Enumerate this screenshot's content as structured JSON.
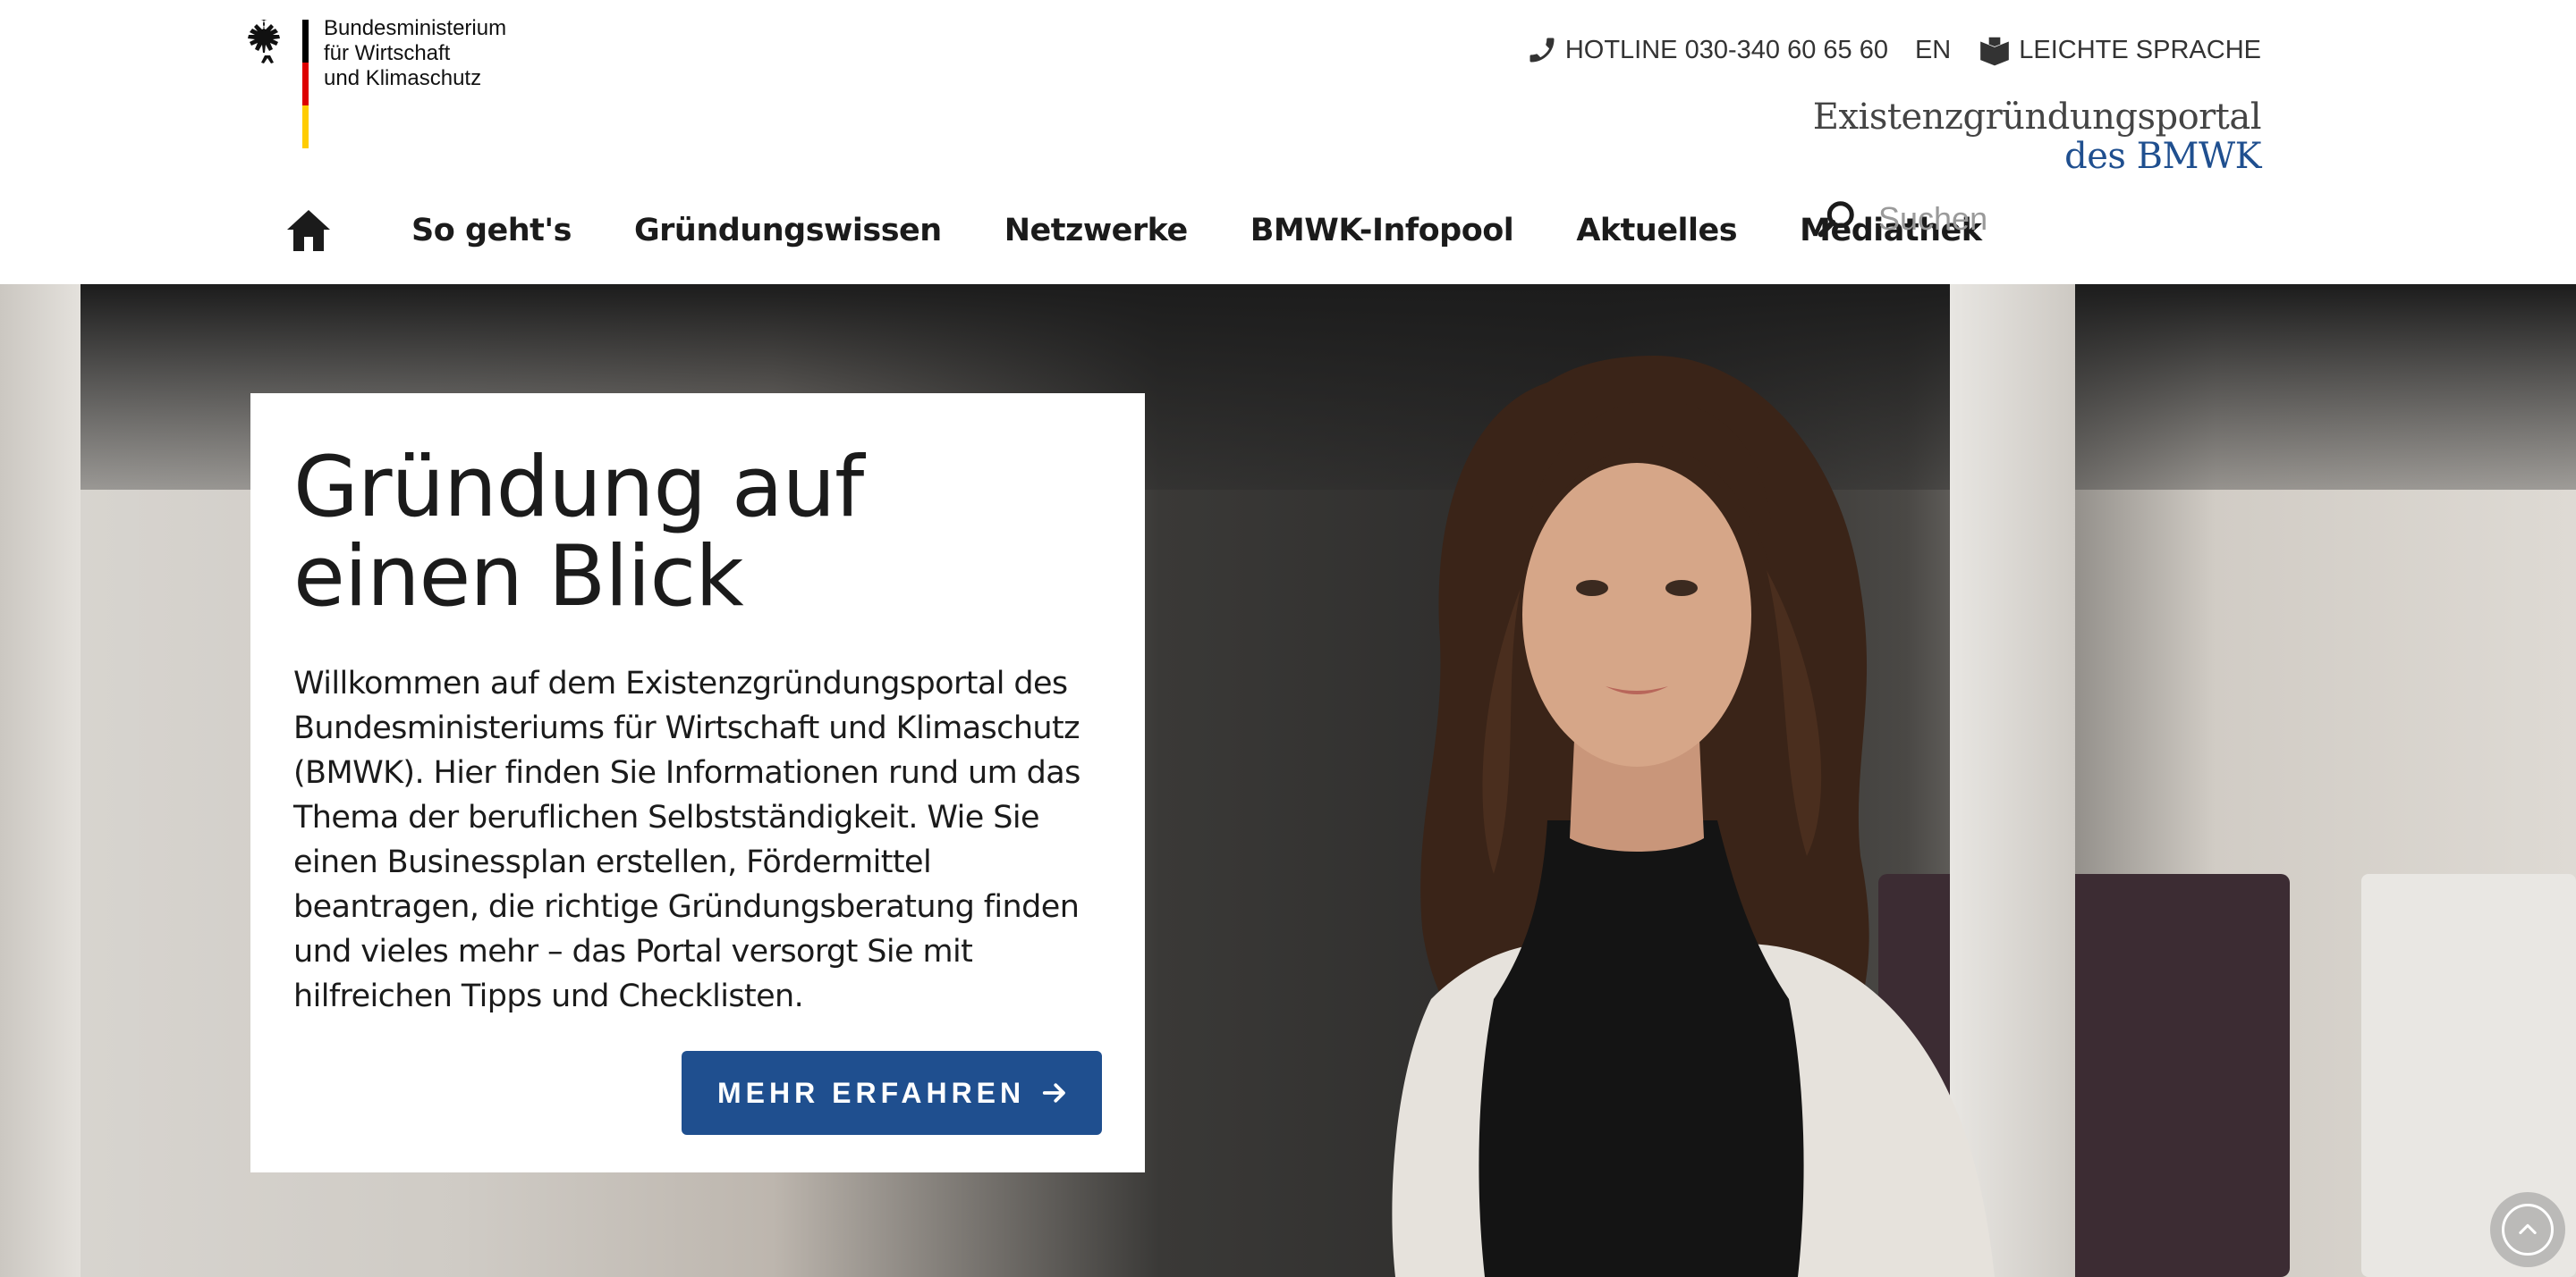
{
  "header": {
    "ministry_lines": [
      "Bundesministerium",
      "für Wirtschaft",
      "und Klimaschutz"
    ],
    "hotline": "HOTLINE 030-340 60 65 60",
    "lang": "EN",
    "easy_language": "LEICHTE SPRACHE",
    "portal_line1": "Existenzgründungsportal",
    "portal_line2": "des BMWK"
  },
  "nav": {
    "items": [
      "So geht's",
      "Gründungswissen",
      "Netzwerke",
      "BMWK-Infopool",
      "Aktuelles",
      "Mediathek"
    ],
    "search_placeholder": "Suchen"
  },
  "hero": {
    "title": "Gründung auf einen Blick",
    "text": "Willkommen auf dem Existenzgründungsportal des Bundesministeriums für Wirtschaft und Klimaschutz (BMWK). Hier finden Sie Informationen rund um das Thema der beruflichen Selbstständigkeit. Wie Sie einen Businessplan erstellen, Fördermittel beantragen, die richtige Gründungsberatung finden und vieles mehr – das Portal versorgt Sie mit hilfreichen Tipps und Checklisten.",
    "button_label": "MEHR ERFAHREN"
  },
  "colors": {
    "accent": "#1f4f8f",
    "flag_black": "#000000",
    "flag_red": "#dd0000",
    "flag_gold": "#ffcc00"
  },
  "icons": [
    "eagle-icon",
    "phone-icon",
    "book-icon",
    "home-icon",
    "search-icon",
    "arrow-right-icon",
    "chevron-up-icon"
  ]
}
